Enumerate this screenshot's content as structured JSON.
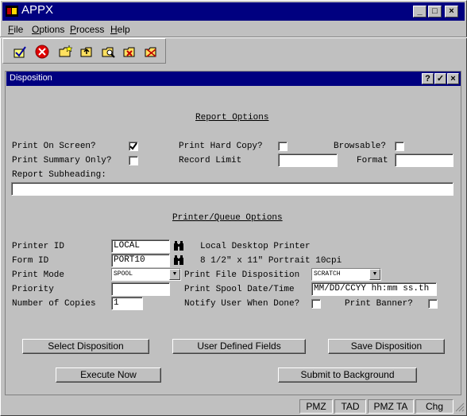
{
  "window": {
    "title": "APPX"
  },
  "title_buttons": [
    "_",
    "□",
    "×"
  ],
  "menu": [
    "File",
    "Options",
    "Process",
    "Help"
  ],
  "toolbar_icons": [
    "confirm-icon",
    "cancel-icon",
    "folder-star-icon",
    "folder-up-icon",
    "folder-search-icon",
    "folder-x-icon",
    "folder-check-icon"
  ],
  "dialog": {
    "title": "Disposition",
    "buttons": [
      "?",
      "✓",
      "×"
    ]
  },
  "report": {
    "heading": "Report Options",
    "print_on_screen_label": "Print On Screen?",
    "print_on_screen_checked": true,
    "print_hard_copy_label": "Print Hard Copy?",
    "print_hard_copy_checked": false,
    "browsable_label": "Browsable?",
    "browsable_checked": false,
    "print_summary_label": "Print Summary Only?",
    "print_summary_checked": false,
    "record_limit_label": "Record Limit",
    "record_limit_value": "",
    "format_label": "Format",
    "format_value": "",
    "subheading_label": "Report Subheading:",
    "subheading_value": ""
  },
  "printer": {
    "heading": "Printer/Queue Options",
    "printer_id_label": "Printer ID",
    "printer_id_value": "LOCAL",
    "printer_desc": "Local Desktop Printer",
    "form_id_label": "Form ID",
    "form_id_value": "PORT10",
    "form_desc": "8 1/2\" x 11\" Portrait 10cpi",
    "print_mode_label": "Print Mode",
    "print_mode_value": "SPOOL",
    "file_disp_label": "Print File Disposition",
    "file_disp_value": "SCRATCH",
    "priority_label": "Priority",
    "priority_value": "",
    "spool_date_label": "Print Spool Date/Time",
    "spool_date_value": "MM/DD/CCYY hh:mm ss.th",
    "copies_label": "Number of Copies",
    "copies_value": "1",
    "notify_label": "Notify User When Done?",
    "notify_checked": false,
    "banner_label": "Print Banner?",
    "banner_checked": false
  },
  "actions": {
    "select_disposition": "Select Disposition",
    "user_defined_fields": "User Defined Fields",
    "save_disposition": "Save Disposition",
    "execute_now": "Execute Now",
    "submit_background": "Submit to Background"
  },
  "status": [
    "PMZ",
    "TAD",
    "PMZ TA",
    "Chg"
  ]
}
